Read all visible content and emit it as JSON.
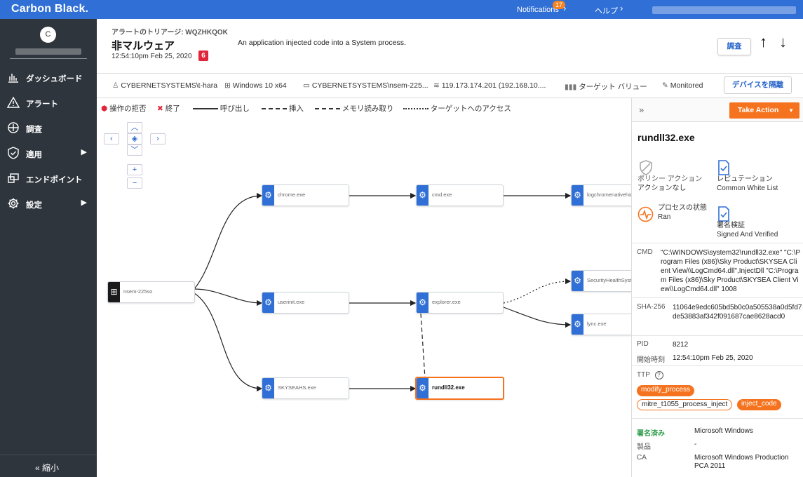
{
  "topbar": {
    "brand": "Carbon Black.",
    "notifications_label": "Notifications",
    "notifications_count": "17",
    "help_label": "ヘルプ"
  },
  "sidebar": {
    "avatar_initial": "C",
    "items": [
      {
        "label": "ダッシュボード",
        "icon": "bar-chart-icon"
      },
      {
        "label": "アラート",
        "icon": "warning-icon"
      },
      {
        "label": "調査",
        "icon": "investigate-icon"
      },
      {
        "label": "適用",
        "icon": "shield-check-icon"
      },
      {
        "label": "エンドポイント",
        "icon": "endpoint-icon"
      },
      {
        "label": "設定",
        "icon": "gear-icon"
      }
    ],
    "collapse_label": "縮小"
  },
  "header": {
    "alert_id": "アラートのトリアージ: WQZHKQOK",
    "title": "非マルウェア",
    "timestamp": "12:54:10pm Feb 25, 2020",
    "severity": "6",
    "description": "An application injected code into a System process.",
    "investigate_button": "調査"
  },
  "device": {
    "user": "CYBERNETSYSTEMS\\t-hara",
    "os": "Windows 10 x64",
    "device_name": "CYBERNETSYSTEMS\\nsem-225...",
    "ip": "119.173.174.201 (192.168.10....",
    "target_value": "ターゲット バリュー",
    "status": "Monitored",
    "isolate_button": "デバイスを隔離"
  },
  "legend": {
    "deny": "操作の拒否",
    "terminate": "終了",
    "call": "呼び出し",
    "inject": "挿入",
    "memread": "メモリ読み取り",
    "target_access": "ターゲットへのアクセス"
  },
  "graph": {
    "nodes": [
      {
        "id": "root",
        "name": "nsem-225so"
      },
      {
        "id": "chrome",
        "name": "chrome.exe"
      },
      {
        "id": "userinit",
        "name": "userinit.exe"
      },
      {
        "id": "skyseahs",
        "name": "SKYSEAHS.exe"
      },
      {
        "id": "cmd",
        "name": "cmd.exe"
      },
      {
        "id": "explorer",
        "name": "explorer.exe"
      },
      {
        "id": "rundll",
        "name": "rundll32.exe"
      },
      {
        "id": "logchrome",
        "name": "logchromenativehost"
      },
      {
        "id": "securityhealth",
        "name": "SecurityHealthSystray"
      },
      {
        "id": "lync",
        "name": "lync.exe"
      }
    ]
  },
  "panel": {
    "take_action": "Take Action",
    "process": "rundll32.exe",
    "policy_label": "ポリシー アクション",
    "policy_value": "アクションなし",
    "reputation_label": "レピュテーション",
    "reputation_value": "Common White List",
    "state_label": "プロセスの状態",
    "state_value": "Ran",
    "signature_label": "署名検証",
    "signature_value": "Signed And Verified",
    "cmd_label": "CMD",
    "cmd_value": "\"C:\\WINDOWS\\system32\\rundll32.exe\" \"C:\\Program Files (x86)\\Sky Product\\SKYSEA Client View\\\\LogCmd64.dll\",InjectDll \"C:\\Program Files (x86)\\Sky Product\\SKYSEA Client View\\\\LogCmd64.dll\" 1008",
    "sha_label": "SHA-256",
    "sha_value": "11064e9edc605bd5b0c0a505538a0d5fd7de53883af342f091687cae8628acd0",
    "pid_label": "PID",
    "pid_value": "8212",
    "start_label": "開始時刻",
    "start_value": "12:54:10pm Feb 25, 2020",
    "ttp_label": "TTP",
    "ttps": [
      "modify_process",
      "mitre_t1055_process_inject",
      "inject_code"
    ],
    "signed_label": "署名済み",
    "signed_value": "Microsoft Windows",
    "product_label": "製品",
    "product_value": "-",
    "ca_label": "CA",
    "ca_value": "Microsoft Windows Production PCA 2011"
  },
  "colors": {
    "brand_blue": "#2f6fd6",
    "accent_orange": "#f5731e",
    "sidebar_bg": "#2e353d",
    "severity_red": "#e0263b"
  }
}
